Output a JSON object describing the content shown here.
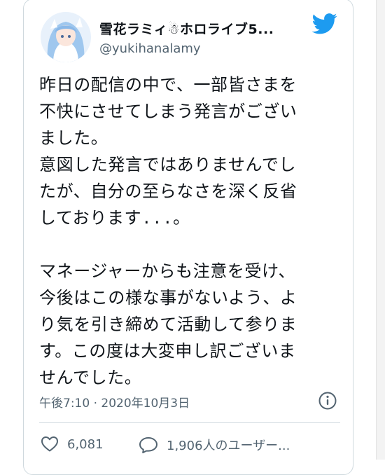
{
  "tweet": {
    "display_name": "雪花ラミィ☃ホロライブ5...",
    "handle": "@yukihanalamy",
    "body": "昨日の配信の中で、一部皆さまを\n不快にさせてしまう発言がござい\nました。\n意図した発言ではありませんでし\nたが、自分の至らなさを深く反省\nしております...。\n\nマネージャーからも注意を受け、\n今後はこの様な事がないよう、よ\nり気を引き締めて活動して参りま\nす。この度は大変申し訳ございま\nせんでした。",
    "timestamp": "午後7:10 · 2020年10月3日",
    "like_count": "6,081",
    "reply_text": "1,906人のユーザー..."
  },
  "icons": {
    "brand": "twitter-bird-icon",
    "info": "info-icon",
    "like": "heart-icon",
    "reply": "speech-bubble-icon"
  },
  "colors": {
    "brand_blue": "#1d9bf0",
    "text_primary": "#0f1419",
    "text_secondary": "#536471",
    "border": "#cfd9de"
  }
}
